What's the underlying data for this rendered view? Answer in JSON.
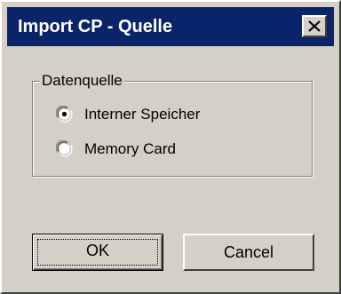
{
  "dialog": {
    "title": "Import CP - Quelle",
    "close_icon": "close-icon"
  },
  "group": {
    "legend": "Datenquelle",
    "options": [
      {
        "label": "Interner Speicher",
        "selected": true
      },
      {
        "label": "Memory Card",
        "selected": false
      }
    ]
  },
  "buttons": {
    "ok_label": "OK",
    "cancel_label": "Cancel"
  },
  "colors": {
    "titlebar": "#0a246a",
    "face": "#d4d0c8"
  }
}
